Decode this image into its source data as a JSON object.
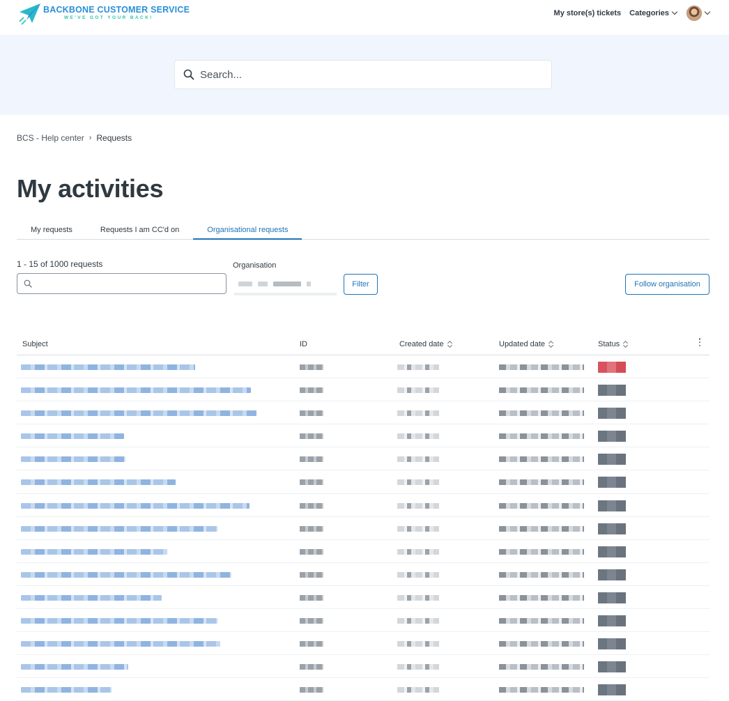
{
  "header": {
    "brand_title": "BACKBONE CUSTOMER SERVICE",
    "brand_tagline": "WE'VE GOT YOUR BACK!",
    "nav_tickets": "My store(s) tickets",
    "nav_categories": "Categories",
    "colors": {
      "brand_blue": "#2a8fd8",
      "brand_teal": "#2bc4a7"
    }
  },
  "hero": {
    "search_placeholder": "Search..."
  },
  "breadcrumb": {
    "root": "BCS - Help center",
    "separator": "›",
    "current": "Requests"
  },
  "page_title": "My activities",
  "tabs": [
    {
      "label": "My requests",
      "active": false
    },
    {
      "label": "Requests I am CC'd on",
      "active": false
    },
    {
      "label": "Organisational requests",
      "active": true
    }
  ],
  "filters": {
    "count_text": "1 - 15 of 1000 requests",
    "organisation_label": "Organisation",
    "filter_button": "Filter",
    "follow_button": "Follow organisation"
  },
  "table": {
    "columns": {
      "subject": "Subject",
      "id": "ID",
      "created": "Created date",
      "updated": "Updated date",
      "status": "Status"
    },
    "row_count": 15,
    "status_colors": {
      "open": "#d9535e",
      "closed": "#6c7680"
    }
  }
}
